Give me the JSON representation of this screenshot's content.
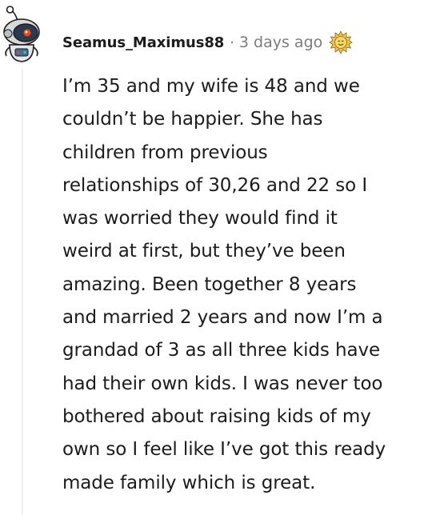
{
  "comment": {
    "username": "Seamus_Maximus88",
    "separator": "·",
    "timestamp": "3 days ago",
    "avatar_icon": "snoo-astronaut-avatar-icon",
    "award_icon": "sun-award-icon",
    "body_lines": [
      "I’m 35 and my wife is 48 and we",
      "couldn’t be happier. She has",
      "children from previous",
      "relationships of 30,26 and 22 so I",
      "was worried they would find it",
      "weird at first, but they’ve been",
      "amazing. Been together 8 years",
      "and married 2 years and now I’m a",
      "grandad of 3 as all three kids have",
      "had their own kids. I was never too",
      "bothered about raising kids of my",
      "own so I feel like I’ve got this ready",
      "made family which is great."
    ]
  },
  "colors": {
    "text": "#1c1c1c",
    "meta": "#7c7c7c",
    "thread_line": "#edeff1",
    "award_gold": "#f2c24b"
  }
}
